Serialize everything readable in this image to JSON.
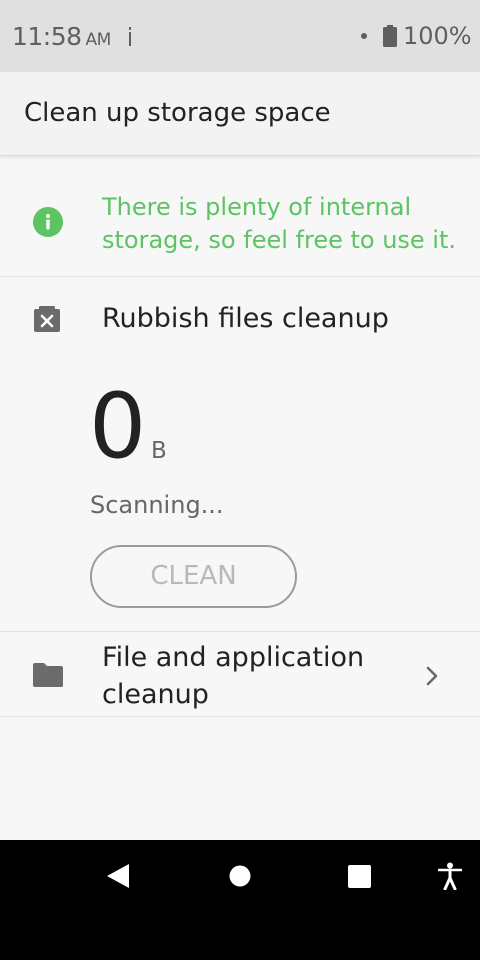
{
  "status_bar": {
    "time": "11:58",
    "ampm": "AM",
    "battery": "100%"
  },
  "app_bar": {
    "title": "Clean up storage space"
  },
  "info": {
    "message": "There is plenty of internal storage, so feel free to use it.",
    "icon": "info-icon",
    "color": "#5cc462"
  },
  "rubbish": {
    "title": "Rubbish files cleanup",
    "icon": "close-box-icon",
    "size_value": "0",
    "size_unit": "B",
    "status": "Scanning...",
    "button_label": "CLEAN"
  },
  "file_cleanup": {
    "title": "File and application cleanup",
    "icon": "folder-icon",
    "chevron": "chevron-right-icon"
  },
  "nav_bar": {
    "buttons": [
      "back-icon",
      "home-icon",
      "recents-icon",
      "accessibility-icon"
    ]
  }
}
